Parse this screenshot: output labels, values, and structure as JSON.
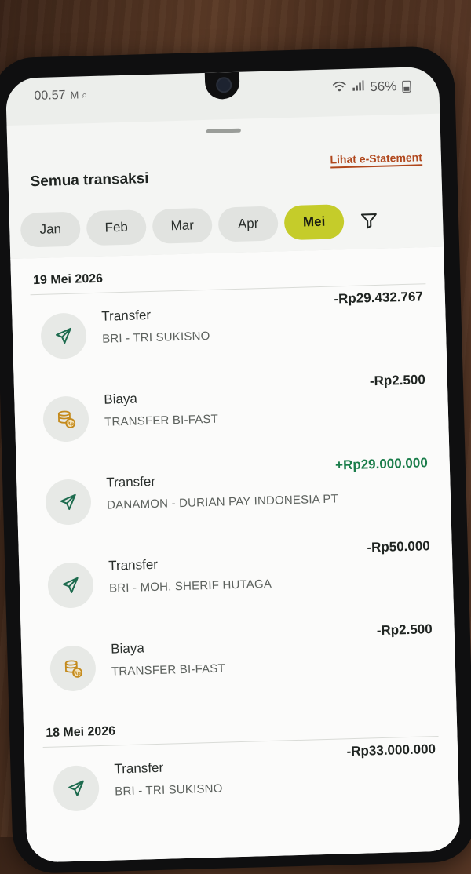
{
  "status_bar": {
    "time": "00.57",
    "notif_icons": "M ⌕",
    "battery": "56%"
  },
  "header": {
    "title": "Semua transaksi",
    "estatement_link": "Lihat e-Statement"
  },
  "tabs": [
    {
      "label": "Jan"
    },
    {
      "label": "Feb"
    },
    {
      "label": "Mar"
    },
    {
      "label": "Apr"
    },
    {
      "label": "Mei",
      "active": true
    }
  ],
  "groups": [
    {
      "date": "19 Mei 2026",
      "items": [
        {
          "type": "Transfer",
          "desc": "BRI - TRI SUKISNO",
          "amount": "-Rp29.432.767",
          "icon": "send-icon"
        },
        {
          "type": "Biaya",
          "desc": "TRANSFER BI-FAST",
          "amount": "-Rp2.500",
          "icon": "coin-stack-icon"
        },
        {
          "type": "Transfer",
          "desc": "DANAMON - DURIAN PAY INDONESIA PT",
          "amount": "+Rp29.000.000",
          "icon": "send-icon",
          "positive": true
        },
        {
          "type": "Transfer",
          "desc": "BRI - MOH. SHERIF HUTAGA",
          "amount": "-Rp50.000",
          "icon": "send-icon"
        },
        {
          "type": "Biaya",
          "desc": "TRANSFER BI-FAST",
          "amount": "-Rp2.500",
          "icon": "coin-stack-icon"
        }
      ]
    },
    {
      "date": "18 Mei 2026",
      "items": [
        {
          "type": "Transfer",
          "desc": "BRI - TRI SUKISNO",
          "amount": "-Rp33.000.000",
          "icon": "send-icon"
        }
      ]
    }
  ],
  "colors": {
    "accent_tab": "#c5cc2a",
    "link": "#b0471c",
    "positive": "#1a7d4a",
    "send_icon": "#1d6b4e",
    "coin_icon": "#c48a1c"
  }
}
